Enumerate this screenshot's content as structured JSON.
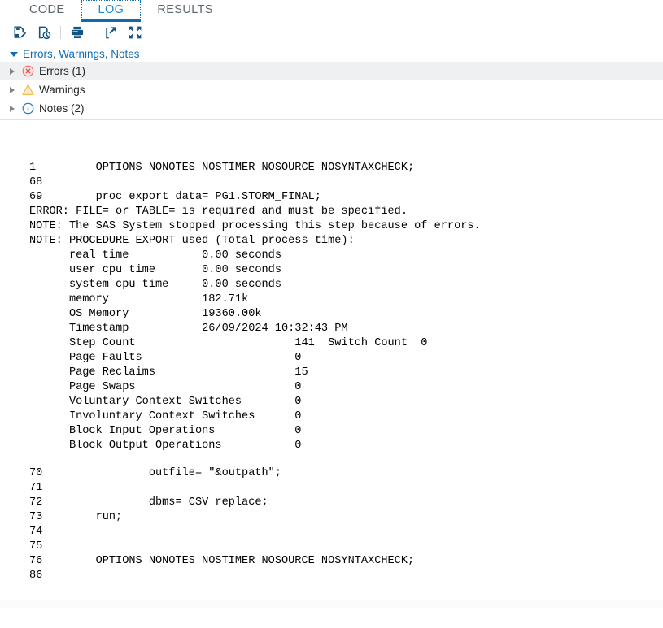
{
  "tabs": [
    {
      "label": "CODE",
      "active": false
    },
    {
      "label": "LOG",
      "active": true
    },
    {
      "label": "RESULTS",
      "active": false
    }
  ],
  "toolbar": {
    "buttons": [
      {
        "name": "save-log-icon",
        "title": "Save log"
      },
      {
        "name": "log-history-icon",
        "title": "Log history"
      },
      {
        "name": "print-icon",
        "title": "Print"
      },
      {
        "name": "open-in-new-window-icon",
        "title": "Open in new window"
      },
      {
        "name": "maximize-icon",
        "title": "Maximize view"
      }
    ]
  },
  "ewn": {
    "header": "Errors, Warnings, Notes",
    "rows": [
      {
        "icon": "error-icon",
        "label": "Errors (1)",
        "selected": true
      },
      {
        "icon": "warning-icon",
        "label": "Warnings",
        "selected": false
      },
      {
        "icon": "note-icon",
        "label": "Notes (2)",
        "selected": false
      }
    ]
  },
  "log": {
    "block1": [
      {
        "num": "1",
        "text": "        OPTIONS NONOTES NOSTIMER NOSOURCE NOSYNTAXCHECK;",
        "color": "black"
      },
      {
        "num": "68",
        "text": "",
        "color": "black"
      },
      {
        "num": "69",
        "text": "        proc export data= PG1.STORM_FINAL;",
        "color": "black"
      }
    ],
    "messages": [
      {
        "text": "ERROR: FILE= or TABLE= is required and must be specified.",
        "color": "red"
      },
      {
        "text": "NOTE: The SAS System stopped processing this step because of errors.",
        "color": "blue"
      },
      {
        "text": "NOTE: PROCEDURE EXPORT used (Total process time):",
        "color": "blue"
      }
    ],
    "stats": [
      {
        "label": "real time",
        "value": "0.00 seconds"
      },
      {
        "label": "user cpu time",
        "value": "0.00 seconds"
      },
      {
        "label": "system cpu time",
        "value": "0.00 seconds"
      },
      {
        "label": "memory",
        "value": "182.71k"
      },
      {
        "label": "OS Memory",
        "value": "19360.00k"
      },
      {
        "label": "Timestamp",
        "value": "26/09/2024 10:32:43 PM"
      },
      {
        "label": "Step Count",
        "value": "141",
        "extra_label": "Switch Count",
        "extra_value": "0"
      },
      {
        "label": "Page Faults",
        "value": "0"
      },
      {
        "label": "Page Reclaims",
        "value": "15"
      },
      {
        "label": "Page Swaps",
        "value": "0"
      },
      {
        "label": "Voluntary Context Switches",
        "value": "0"
      },
      {
        "label": "Involuntary Context Switches",
        "value": "0"
      },
      {
        "label": "Block Input Operations",
        "value": "0"
      },
      {
        "label": "Block Output Operations",
        "value": "0"
      }
    ],
    "block2": [
      {
        "num": "70",
        "text": "                outfile= \"&outpath\";"
      },
      {
        "num": "71",
        "text": ""
      },
      {
        "num": "72",
        "text": "                dbms= CSV replace;"
      },
      {
        "num": "73",
        "text": "      run;"
      },
      {
        "num": "74",
        "text": ""
      },
      {
        "num": "75",
        "text": ""
      },
      {
        "num": "76",
        "text": "        OPTIONS NONOTES NOSTIMER NOSOURCE NOSYNTAXCHECK;"
      },
      {
        "num": "86",
        "text": ""
      }
    ],
    "rendered_block1": "1         OPTIONS NONOTES NOSTIMER NOSOURCE NOSYNTAXCHECK;\n68\n69        proc export data= PG1.STORM_FINAL;",
    "rendered_error": "ERROR: FILE= or TABLE= is required and must be specified.",
    "rendered_notes": "NOTE: The SAS System stopped processing this step because of errors.\nNOTE: PROCEDURE EXPORT used (Total process time):",
    "rendered_stats": "      real time           0.00 seconds\n      user cpu time       0.00 seconds\n      system cpu time     0.00 seconds\n      memory              182.71k\n      OS Memory           19360.00k\n      Timestamp           26/09/2024 10:32:43 PM\n      Step Count                        141  Switch Count  0\n      Page Faults                       0\n      Page Reclaims                     15\n      Page Swaps                        0\n      Voluntary Context Switches        0\n      Involuntary Context Switches      0\n      Block Input Operations            0\n      Block Output Operations           0",
    "rendered_block2": "70                outfile= \"&outpath\";\n71\n72                dbms= CSV replace;\n73        run;\n74\n75\n76        OPTIONS NONOTES NOSTIMER NOSOURCE NOSYNTAXCHECK;\n86"
  },
  "colors": {
    "accent": "#0c6cb4",
    "tab_active_text": "#1f8ad2",
    "tab_text": "#5b6770",
    "link_blue": "#0f6cb6",
    "log_blue": "#0000d2",
    "log_red": "#ff0000",
    "icon_navy": "#14537f",
    "error_red": "#f5736e",
    "warning_amber": "#f5bc4b",
    "note_blue": "#2b7cc1",
    "row_selected_bg": "#eff0f2"
  }
}
